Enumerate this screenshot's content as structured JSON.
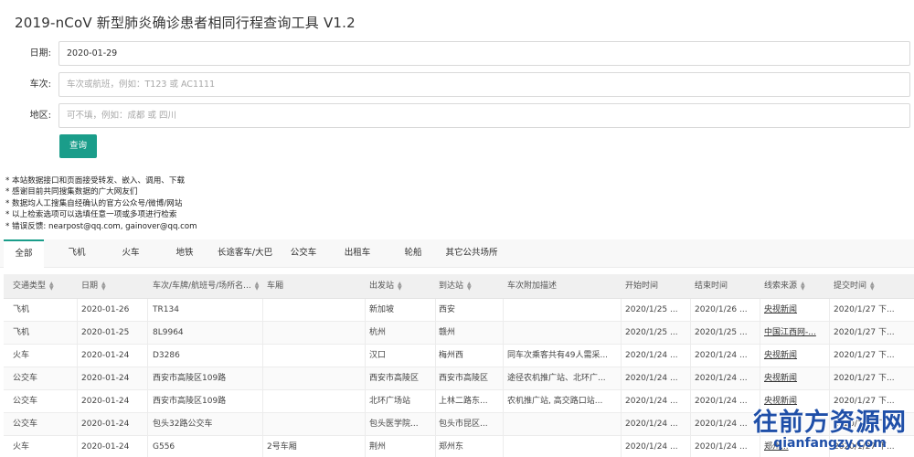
{
  "app": {
    "title": "2019-nCoV 新型肺炎确诊患者相同行程查询工具 V1.2"
  },
  "form": {
    "date": {
      "label": "日期:",
      "value": "2020-01-29"
    },
    "train": {
      "label": "车次:",
      "placeholder": "车次或航班，例如：T123 或 AC1111"
    },
    "region": {
      "label": "地区:",
      "placeholder": "可不填，例如：成都 或 四川"
    },
    "search_label": "查询"
  },
  "notes": [
    "* 本站数据接口和页面接受转发、嵌入、调用、下载",
    "* 感谢目前共同搜集数据的广大网友们",
    "* 数据均人工搜集自经确认的官方公众号/微博/网站",
    "* 以上检索选项可以选填任意一项或多项进行检索",
    "* 错误反馈: nearpost@qq.com, gainover@qq.com"
  ],
  "tabs": [
    "全部",
    "飞机",
    "火车",
    "地铁",
    "长途客车/大巴",
    "公交车",
    "出租车",
    "轮船",
    "其它公共场所"
  ],
  "table": {
    "headers": [
      "交通类型",
      "日期",
      "车次/车牌/航班号/场所名...",
      "车厢",
      "出发站",
      "到达站",
      "车次附加描述",
      "开始时间",
      "结束时间",
      "线索来源",
      "提交时间"
    ],
    "rows": [
      [
        "飞机",
        "2020-01-26",
        "TR134",
        "",
        "新加坡",
        "西安",
        "",
        "2020/1/25 ...",
        "2020/1/26 ...",
        "央视新闻",
        "2020/1/27 下..."
      ],
      [
        "飞机",
        "2020-01-25",
        "8L9964",
        "",
        "杭州",
        "赣州",
        "",
        "2020/1/25 ...",
        "2020/1/25 ...",
        "中国江西网-...",
        "2020/1/27 下..."
      ],
      [
        "火车",
        "2020-01-24",
        "D3286",
        "",
        "汉口",
        "梅州西",
        "同车次乘客共有49人需采...",
        "2020/1/24 ...",
        "2020/1/24 ...",
        "央视新闻",
        "2020/1/27 下..."
      ],
      [
        "公交车",
        "2020-01-24",
        "西安市高陵区109路",
        "",
        "西安市高陵区",
        "西安市高陵区",
        "途径农机推广站、北环广...",
        "2020/1/24 ...",
        "2020/1/24 ...",
        "央视新闻",
        "2020/1/27 下..."
      ],
      [
        "公交车",
        "2020-01-24",
        "西安市高陵区109路",
        "",
        "北环广场站",
        "上林二路东...",
        "农机推广站, 高交路口站...",
        "2020/1/24 ...",
        "2020/1/24 ...",
        "央视新闻",
        "2020/1/27 下..."
      ],
      [
        "公交车",
        "2020-01-24",
        "包头32路公交车",
        "",
        "包头医学院...",
        "包头市昆区...",
        "",
        "2020/1/24 ...",
        "2020/1/24 ...",
        "",
        "2020/1/27 下..."
      ],
      [
        "火车",
        "2020-01-24",
        "G556",
        "2号车厢",
        "荆州",
        "郑州东",
        "",
        "2020/1/24 ...",
        "2020/1/24 ...",
        "郑州...",
        "2020/1/27 下..."
      ]
    ]
  },
  "watermark": {
    "main": "往前方资源网",
    "sub": "qianfangzy.com"
  },
  "colors": {
    "accent": "#1a9d8a",
    "watermark": "#1f4fa8"
  }
}
